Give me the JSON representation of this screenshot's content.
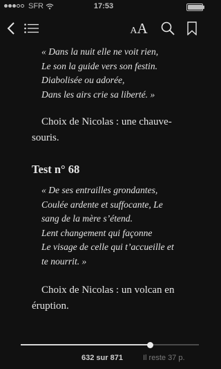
{
  "status_bar": {
    "signal_bars": 3,
    "signal_total": 5,
    "carrier": "SFR",
    "wifi_icon": "wifi-icon",
    "time": "17:53",
    "battery_level": 1.0
  },
  "toolbar": {
    "back_icon": "chevron-left-icon",
    "toc_icon": "list-icon",
    "font_label": "AA",
    "search_icon": "search-icon",
    "bookmark_icon": "bookmark-icon"
  },
  "content": {
    "verse1": [
      "« Dans la nuit elle ne voit rien,",
      "Le son la guide vers son festin.",
      "Diabolisée ou adorée,",
      "Dans les airs crie sa liberté. »"
    ],
    "answer1": "Choix de Nicolas : une chauve-souris.",
    "test_heading": "Test n° 68",
    "verse2": [
      "« De ses entrailles grondantes,",
      "Coulée ardente et suffocante, Le",
      "sang de la mère s’étend.",
      "Lent changement qui façonne",
      "Le visage de celle qui t’accueille et",
      "te nourrit. »"
    ],
    "answer2": "Choix de Nicolas : un volcan en éruption."
  },
  "footer": {
    "current_page": 632,
    "total_pages": 871,
    "pages_label": "632 sur 871",
    "remaining_label": "Il reste 37 p.",
    "progress_fraction": 0.7256
  },
  "colors": {
    "background": "#111111",
    "text": "#e6e6e6",
    "muted": "#7a7a7a"
  }
}
